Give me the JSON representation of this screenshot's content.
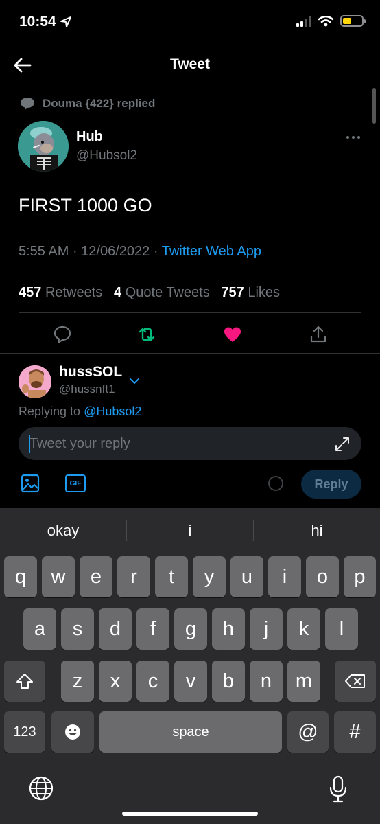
{
  "status_bar": {
    "time": "10:54"
  },
  "header": {
    "title": "Tweet"
  },
  "tweet": {
    "context": "Douma {422} replied",
    "author_name": "Hub",
    "author_handle": "@Hubsol2",
    "text": "FIRST 1000 GO",
    "time": "5:55 AM",
    "separator": " · ",
    "date": "12/06/2022",
    "source": "Twitter Web App",
    "retweets_count": "457",
    "retweets_label": "Retweets",
    "quotes_count": "4",
    "quotes_label": "Quote Tweets",
    "likes_count": "757",
    "likes_label": "Likes"
  },
  "composer": {
    "user_name": "hussSOL",
    "user_handle": "@hussnft1",
    "replying_prefix": "Replying to ",
    "replying_mention": "@Hubsol2",
    "placeholder": "Tweet your reply",
    "gif_label": "GIF",
    "reply_button": "Reply"
  },
  "keyboard": {
    "suggestions": [
      "okay",
      "i",
      "hi"
    ],
    "row1": [
      "q",
      "w",
      "e",
      "r",
      "t",
      "y",
      "u",
      "i",
      "o",
      "p"
    ],
    "row2": [
      "a",
      "s",
      "d",
      "f",
      "g",
      "h",
      "j",
      "k",
      "l"
    ],
    "row3": [
      "z",
      "x",
      "c",
      "v",
      "b",
      "n",
      "m"
    ],
    "numbers_key": "123",
    "space_key": "space",
    "at_key": "@",
    "hash_key": "#"
  },
  "colors": {
    "accent": "#1d9bf0",
    "retweet": "#00ba7c",
    "like": "#f91880",
    "background": "#000000"
  }
}
